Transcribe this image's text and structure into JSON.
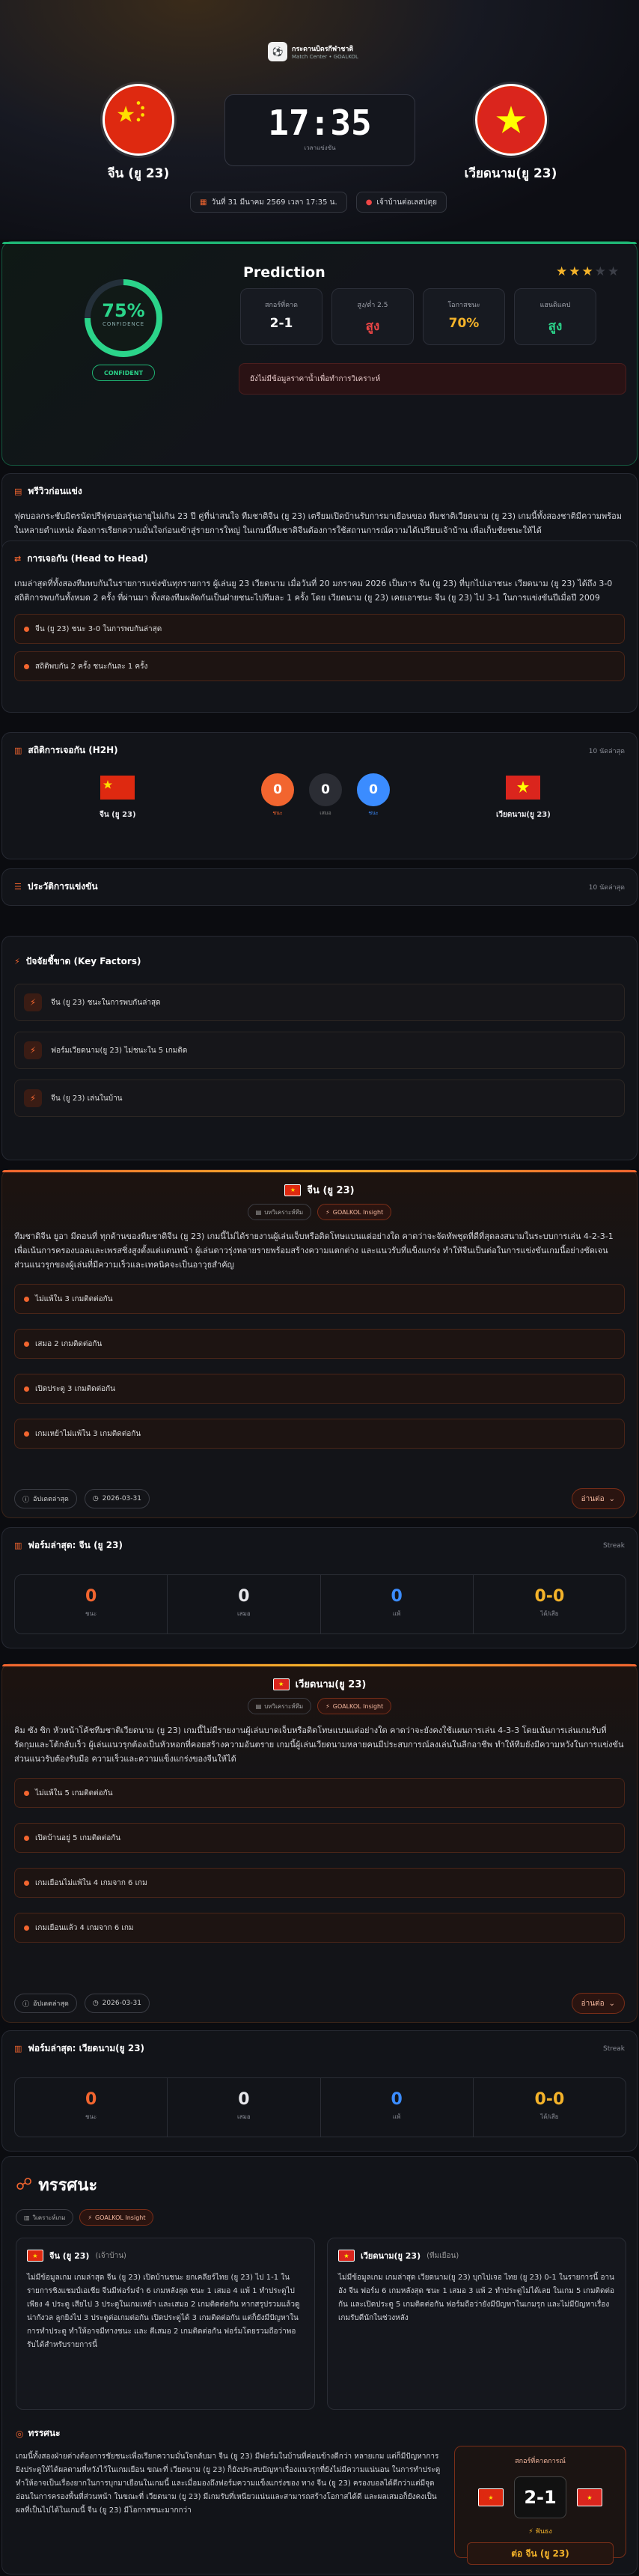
{
  "header": {
    "brand_title": "กระดานบิดรกีฬาชาติ",
    "brand_sub": "Match Center • GOALKOL",
    "time": "17:35",
    "time_sub": "เวลาแข่งขัน",
    "date": "วันที่ 31 มีนาคม 2569 เวลา 17:35 น.",
    "venue": "เจ้าบ้านต่อเลสปตุย"
  },
  "home": {
    "name": "จีน (ยู 23)",
    "short": "CN"
  },
  "away": {
    "name": "เวียดนาม(ยู 23)",
    "short": "VN"
  },
  "prediction": {
    "title": "Prediction",
    "confidence": "75%",
    "confidence_label": "CONFIDENCE",
    "confidence_badge": "CONFIDENT",
    "stars": 3,
    "stars_max": 5,
    "cells": [
      {
        "k": "สกอร์ที่คาด",
        "v": "2-1",
        "c": "#ffffff"
      },
      {
        "k": "สูง/ต่ำ 2.5",
        "v": "สูง",
        "c": "#ef4646"
      },
      {
        "k": "โอกาสชนะ",
        "v": "70%",
        "c": "#f4b32a"
      },
      {
        "k": "แฮนดิแคป",
        "v": "สูง",
        "c": "#2bd48a"
      }
    ],
    "advice": "ยังไม่มีข้อมูลราคาน้ำเพื่อทำการวิเคราะห์"
  },
  "preview": {
    "title": "พรีวิวก่อนแข่ง",
    "text": "ฟุตบอลกระชับมิตรนัดปรีฟุตบอลรุ่นอายุไม่เกิน 23 ปี คู่ที่น่าสนใจ ทีมชาติจีน (ยู 23) เตรียมเปิดบ้านรับการมาเยือนของ ทีมชาติเวียดนาม (ยู 23) เกมนี้ทั้งสองชาติมีความพร้อมในหลายตำแหน่ง ต้องการเรียกความมั่นใจก่อนเข้าสู่รายการใหญ่ ในเกมนี้ทีมชาติจีนต้องการใช้สถานการณ์ความได้เปรียบเจ้าบ้าน เพื่อเก็บชัยชนะให้ได้"
  },
  "h2h_text": {
    "title": "การเจอกัน (Head to Head)",
    "text": "เกมล่าสุดที่ทั้งสองทีมพบกันในรายการแข่งขันทุกรายการ ผู้เล่นยู 23 เวียดนาม เมื่อวันที่ 20 มกราคม 2026 เป็นการ จีน (ยู 23) ที่บุกไปเอาชนะ เวียดนาม (ยู 23) ได้ถึง 3-0 สถิติการพบกันทั้งหมด 2 ครั้ง ที่ผ่านมา ทั้งสองทีมผลัดกันเป็นฝ่ายชนะไปทีมละ 1 ครั้ง โดย เวียดนาม (ยู 23) เคยเอาชนะ จีน (ยู 23) ไป 3-1 ในการแข่งขันปีเมื่อปี 2009",
    "bullets": [
      "จีน (ยู 23) ชนะ 3-0 ในการพบกันล่าสุด",
      "สถิติพบกัน 2 ครั้ง ชนะกันละ 1 ครั้ง"
    ]
  },
  "h2h_stats": {
    "title": "สถิติการเจอกัน (H2H)",
    "right": "10 นัดล่าสุด",
    "home_wins": "0",
    "draws": "0",
    "away_wins": "0",
    "home_label": "ชนะ",
    "draw_label": "เสมอ",
    "away_label": "ชนะ"
  },
  "history": {
    "title": "ประวัติการแข่งขัน",
    "right": "10 นัดล่าสุด"
  },
  "key_factors": {
    "title": "ปัจจัยชี้ขาด (Key Factors)",
    "items": [
      "จีน (ยู 23) ชนะในการพบกันล่าสุด",
      "ฟอร์มเวียดนาม(ยู 23) ไม่ชนะใน 5 เกมติด",
      "จีน (ยู 23) เล่นในบ้าน"
    ]
  },
  "home_card": {
    "name": "จีน (ยู 23)",
    "tag1": "บทวิเคราะห์ทีม",
    "tag2": "GOALKOL Insight",
    "text": "ทีมชาติจีน ยูอา มีตอนที่ ทุกด้านของทีมชาติจีน (ยู 23) เกมนี้ไม่ได้รายงานผู้เล่นเจ็บหรือติดโทษแบนแต่อย่างใด คาดว่าจะจัดทัพชุดที่ดีที่สุดลงสนามในระบบการเล่น 4-2-3-1 เพื่อเน้นการครองบอลและเพรสซิ่งสูงตั้งแต่แดนหน้า ผู้เล่นดาวรุ่งหลายรายพร้อมสร้างความแตกต่าง และแนวรับที่แข็งแกร่ง ทำให้จีนเป็นต่อในการแข่งขันเกมนี้อย่างชัดเจน ส่วนแนวรุกของผู้เล่นที่มีความเร็วและเทคนิคจะเป็นอาวุธสำคัญ",
    "bullets": [
      "ไม่แพ้ใน 3 เกมติดต่อกัน",
      "เสมอ 2 เกมติดต่อกัน",
      "เปิดประตู 3 เกมติดต่อกัน",
      "เกมเหย้าไม่แพ้ใน 3 เกมติดต่อกัน"
    ],
    "footer_label": "อัปเดตล่าสุด",
    "date": "2026-03-31",
    "more": "อ่านต่อ"
  },
  "home_form": {
    "title": "ฟอร์มล่าสุด: จีน (ยู 23)",
    "right": "Streak",
    "w": "0",
    "d": "0",
    "l": "0",
    "gd": "0-0",
    "w_lbl": "ชนะ",
    "d_lbl": "เสมอ",
    "l_lbl": "แพ้",
    "gd_lbl": "ได้/เสีย"
  },
  "away_card": {
    "name": "เวียดนาม(ยู 23)",
    "tag1": "บทวิเคราะห์ทีม",
    "tag2": "GOALKOL Insight",
    "text": "คิม ซัง ซิก หัวหน้าโค้ชทีมชาติเวียดนาม (ยู 23) เกมนี้ไม่มีรายงานผู้เล่นบาดเจ็บหรือติดโทษแบนแต่อย่างใด คาดว่าจะยังคงใช้แผนการเล่น 4-3-3 โดยเน้นการเล่นเกมรับที่รัดกุมและโต้กลับเร็ว ผู้เล่นแนวรุกต้องเป็นหัวหอกที่คอยสร้างความอันตราย เกมนี้ผู้เล่นเวียดนามหลายคนมีประสบการณ์ลงเล่นในลีกอาชีพ ทำให้ทีมยังมีความหวังในการแข่งขัน ส่วนแนวรับต้องรับมือ ความเร็วและความแข็งแกร่งของจีนให้ได้",
    "bullets": [
      "ไม่แพ้ใน 5 เกมติดต่อกัน",
      "เปิดบ้านอยู่ 5 เกมติดต่อกัน",
      "เกมเยือนไม่แพ้ใน 4 เกมจาก 6 เกม",
      "เกมเยือนแล้ว 4 เกมจาก 6 เกม"
    ],
    "footer_label": "อัปเดตล่าสุด",
    "date": "2026-03-31",
    "more": "อ่านต่อ"
  },
  "away_form": {
    "title": "ฟอร์มล่าสุด: เวียดนาม(ยู 23)",
    "right": "Streak",
    "w": "0",
    "d": "0",
    "l": "0",
    "gd": "0-0",
    "w_lbl": "ชนะ",
    "d_lbl": "เสมอ",
    "l_lbl": "แพ้",
    "gd_lbl": "ได้/เสีย"
  },
  "analysis": {
    "title": "ทรรศนะ",
    "tag1": "วิเคราะห์เกม",
    "tag2": "GOALKOL Insight",
    "home_head": "จีน (ยู 23)",
    "home_role": "(เจ้าบ้าน)",
    "away_head": "เวียดนาม(ยู 23)",
    "away_role": "(ทีมเยือน)",
    "home_text": "ไม่มีข้อมูลเกม เกมล่าสุด จีน (ยู 23) เปิดบ้านชนะ ยกเคลียร์ไทย (ยู 23) ไป 1-1 ในรายการชิงแชมป์เอเชีย จีนมีฟอร์มจำ 6 เกมหลังสุด ชนะ 1 เสมอ 4 แพ้ 1 ทำประตูไปเพียง 4 ประตู เสียไป 3 ประตูในเกมเหย้า และเสมอ 2 เกมติดต่อกัน หากสรุปรวมแล้วดูน่ากังวล ลูกยิงไป 3 ประตูต่อเกมต่อกัน เปิดประตูได้ 3 เกมติดต่อกัน แต่ก็ยังมีปัญหาในการทำประตู ทำให้อาจมีทางชนะ และ ตีเสมอ 2 เกมติดต่อกัน ฟอร์มโดยรวมถือว่าพอรับได้สำหรับรายการนี้",
    "away_text": "ไม่มีข้อมูลเกม เกมล่าสุด เวียดนาม(ยู 23) บุกไปเจอ ไทย (ยู 23) 0-1 ในรายการนี้ อาน อัง จีน ฟอร์ม 6 เกมหลังสุด ชนะ 1 เสมอ 3 แพ้ 2 ทำประตูไม่ได้เลย ในเกม 5 เกมติดต่อกัน และเปิดประตู 5 เกมติดต่อกัน ฟอร์มถือว่ายังมีปัญหาในเกมรุก และไม่มีปัญหาเรื่องเกมรับดีนักในช่วงหลัง",
    "summary_title": "ทรรศนะ",
    "summary_text": "เกมนี้ทั้งสองฝ่ายต่างต้องการชัยชนะเพื่อเรียกความมั่นใจกลับมา จีน (ยู 23) มีฟอร์มในบ้านที่ค่อนข้างดีกว่า หลายเกม แต่ก็มีปัญหาการยิงประตูให้ได้ผลตามที่หวังไว้ในเกมเยือน ขณะที่ เวียดนาม (ยู 23) ก็ยังประสบปัญหาเรื่องแนวรุกที่ยังไม่มีความแน่นอน ในการทำประตูทำให้อาจเป็นเรื่องยากในการบุกมาเยือนในเกมนี้ และเมื่อมองถึงฟอร์มความแข็งแกร่งของ ทาง จีน (ยู 23) ครองบอลได้ดีกว่าแต่มีจุดอ่อนในการครองพื้นที่ส่วนหน้า ในขณะที่ เวียดนาม (ยู 23) มีเกมรับที่เหนียวแน่นและสามารถสร้างโอกาสได้ดี และผลเสมอก็ยังคงเป็นผลที่เป็นไปได้ในเกมนี้ จีน (ยู 23) มีโอกาสชนะมากกว่า",
    "score_label": "สกอร์ที่คาดการณ์",
    "score": "2-1",
    "score_sub": "ฟันธง",
    "pick": "ต่อ จีน (ยู 23)"
  },
  "colors": {
    "accent": "#f2652f",
    "green": "#2bd48a",
    "gold": "#f4b32a",
    "blue": "#3b8cff",
    "red": "#ef4646"
  }
}
